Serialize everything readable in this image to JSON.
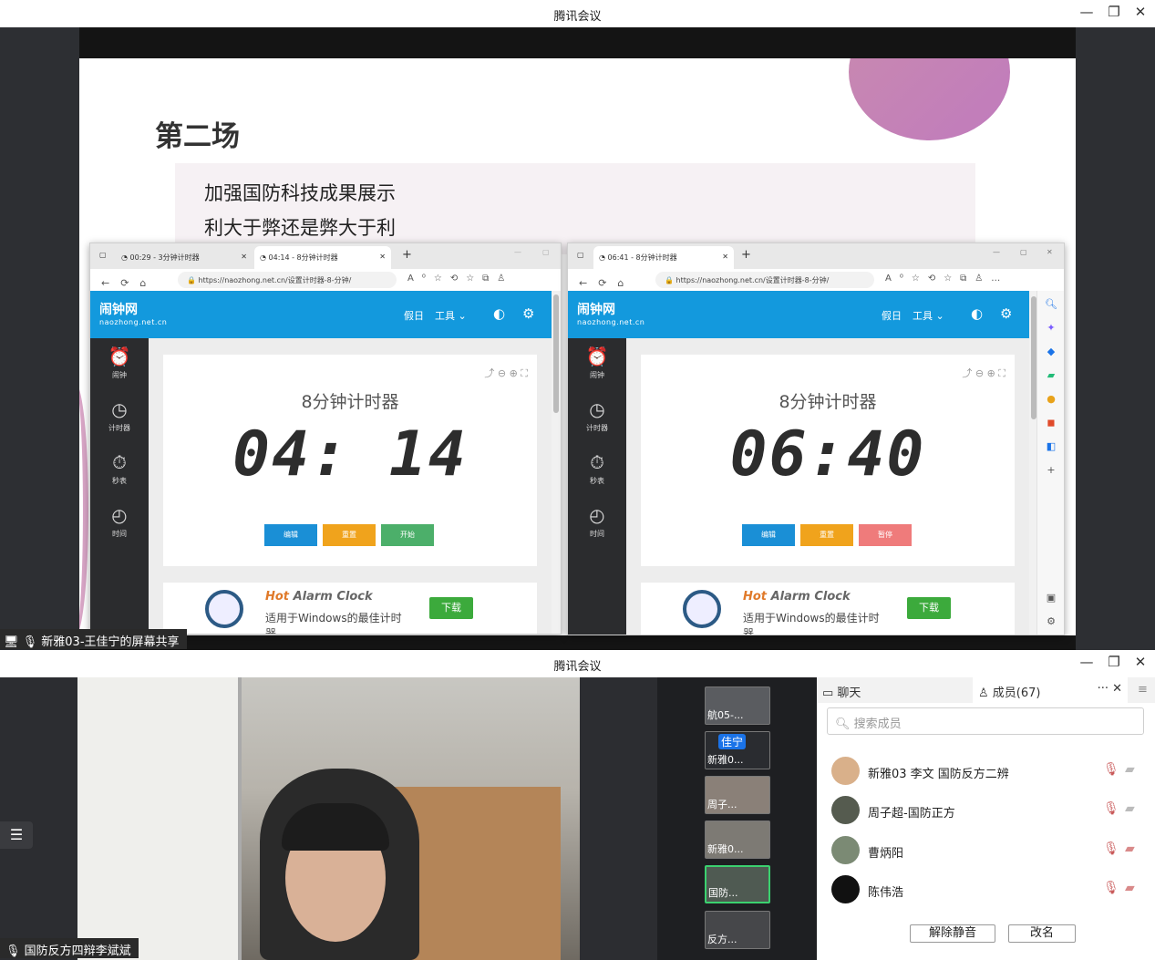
{
  "top_window": {
    "title": "腾讯会议",
    "minimize": "—",
    "restore": "❐",
    "close": "✕",
    "share_label": "新雅03-王佳宁的屏幕共享"
  },
  "slide": {
    "heading": "第二场",
    "line1": "加强国防科技成果展示",
    "line2": "利大于弊还是弊大于利"
  },
  "browser_left": {
    "tab1": "00:29 - 3分钟计时器",
    "tab2": "04:14 - 8分钟计时器",
    "url": "https://naozhong.net.cn/设置计时器-8-分钟/",
    "timer_title": "8分钟计时器",
    "digits": "04: 14",
    "buttons": [
      "编辑",
      "重置",
      "开始"
    ],
    "button_colors": [
      "#1a8fd6",
      "#f0a31c",
      "#4caf6a"
    ]
  },
  "browser_right": {
    "tab1": "06:41 - 8分钟计时器",
    "url": "https://naozhong.net.cn/设置计时器-8-分钟/",
    "timer_title": "8分钟计时器",
    "digits": "06:40",
    "buttons": [
      "编辑",
      "重置",
      "暂停"
    ],
    "button_colors": [
      "#1a8fd6",
      "#f0a31c",
      "#ef7b7b"
    ]
  },
  "site": {
    "logo": "闹钟网",
    "domain": "naozhong.net.cn",
    "nav_holiday": "假日",
    "nav_tools": "工具 ⌄",
    "sidebar": [
      "闹钟",
      "计时器",
      "秒表",
      "时间"
    ],
    "ad_hot": "Hot",
    "ad_title": "Alarm Clock",
    "ad_desc": "适用于Windows的最佳计时器",
    "ad_download": "下载"
  },
  "bottom_window": {
    "title": "腾讯会议",
    "speaker_label": "国防反方四辩李斌斌"
  },
  "gallery": [
    "航05-...",
    "新雅0...",
    "周子...",
    "新雅0...",
    "国防...",
    "反方..."
  ],
  "gallery_avatar_text": "佳宁",
  "panel": {
    "chat_tab": "聊天",
    "members_tab": "成员(67)",
    "search_placeholder": "搜索成员",
    "members": [
      "新雅03 李文 国防反方二辨",
      "周子超-国防正方",
      "曹炳阳",
      "陈伟浩"
    ],
    "unmute_all": "解除静音",
    "rename": "改名"
  }
}
